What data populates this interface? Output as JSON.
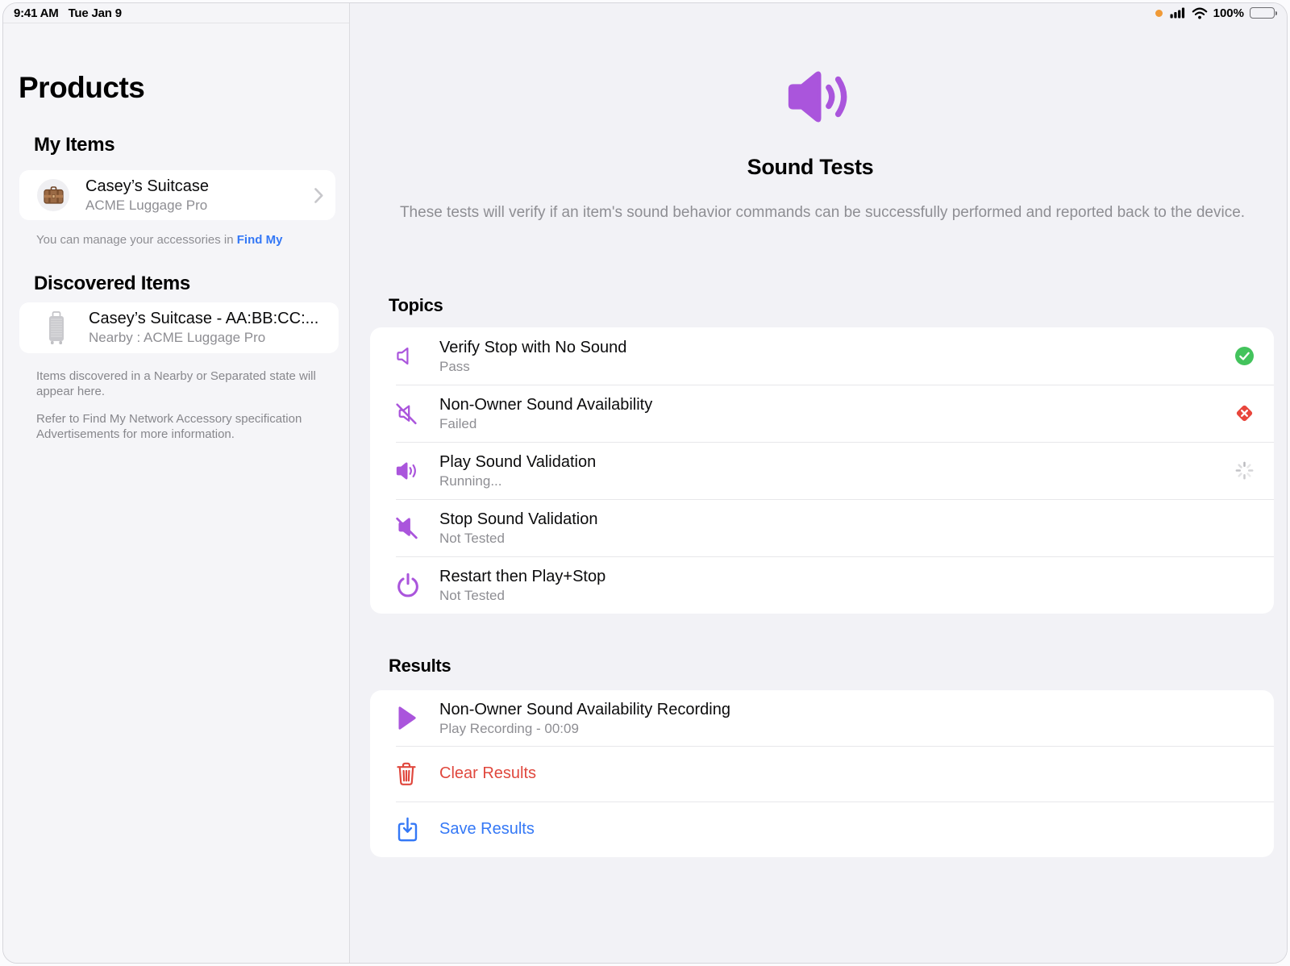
{
  "status_bar": {
    "time": "9:41 AM",
    "date": "Tue Jan 9",
    "battery_percent": "100%",
    "icons": [
      "recording-indicator-dot",
      "cellular-signal-icon",
      "wifi-icon",
      "battery-icon"
    ]
  },
  "sidebar": {
    "title": "Products",
    "my_items": {
      "header": "My Items",
      "item": {
        "icon": "suitcase-emoji-icon",
        "title": "Casey’s Suitcase",
        "subtitle": "ACME Luggage Pro"
      },
      "note_prefix": "You can manage your accessories in ",
      "note_link": "Find My"
    },
    "discovered": {
      "header": "Discovered Items",
      "item": {
        "icon": "rolling-luggage-icon",
        "title": "Casey’s Suitcase - AA:BB:CC:...",
        "subtitle": "Nearby : ACME Luggage Pro"
      },
      "footnote1": "Items discovered in a Nearby or Separated state will appear here.",
      "footnote2": "Refer to Find My Network Accessory specification Advertisements for more information."
    }
  },
  "main": {
    "hero_icon": "speaker-wave-icon",
    "title": "Sound Tests",
    "description": "These tests will verify if an item's sound behavior commands can be successfully performed and reported back to the device.",
    "topics": {
      "header": "Topics",
      "rows": [
        {
          "icon": "speaker-outline-icon",
          "title": "Verify Stop with No Sound",
          "status_text": "Pass",
          "status": "pass"
        },
        {
          "icon": "speaker-slash-outline-icon",
          "title": "Non-Owner Sound Availability",
          "status_text": "Failed",
          "status": "failed"
        },
        {
          "icon": "speaker-wave-fill-icon",
          "title": "Play Sound Validation",
          "status_text": "Running...",
          "status": "running"
        },
        {
          "icon": "speaker-slash-fill-icon",
          "title": "Stop Sound Validation",
          "status_text": "Not Tested",
          "status": "none"
        },
        {
          "icon": "power-icon",
          "title": "Restart then Play+Stop",
          "status_text": "Not Tested",
          "status": "none"
        }
      ]
    },
    "results": {
      "header": "Results",
      "recording": {
        "icon": "play-icon",
        "title": "Non-Owner Sound Availability Recording",
        "subtitle": "Play Recording - 00:09"
      },
      "clear_label": "Clear Results",
      "save_label": "Save Results"
    }
  },
  "colors": {
    "purple": "#AA55DC",
    "green": "#43C35C",
    "red_status": "#E8463C",
    "red_action": "#E0483E",
    "blue": "#3478F6",
    "secondary_text": "#8E8E93"
  }
}
